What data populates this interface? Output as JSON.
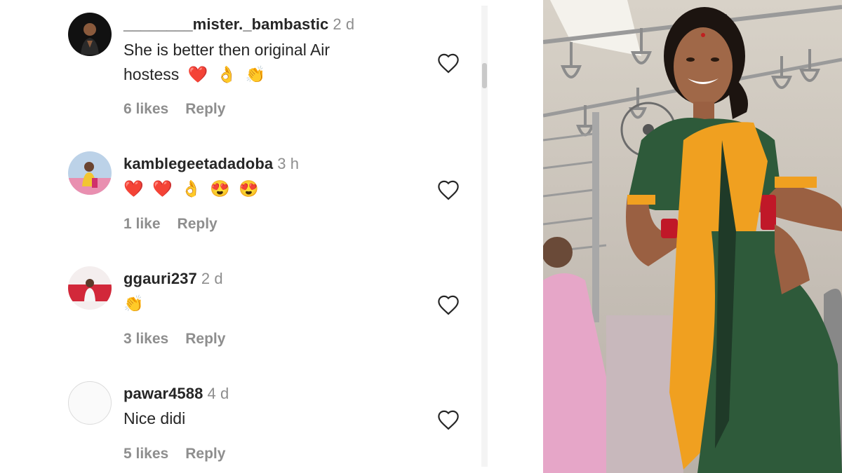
{
  "comments": [
    {
      "username": "________mister._bambastic",
      "time": "2 d",
      "text_line1": "She is better then original Air",
      "text_line2": "hostess",
      "emojis": [
        "❤️",
        "👌",
        "👏"
      ],
      "likes": "6 likes",
      "reply": "Reply"
    },
    {
      "username": "kamblegeetadadoba",
      "time": "3 h",
      "emojis": [
        "❤️",
        "❤️",
        "👌",
        "😍",
        "😍"
      ],
      "likes": "1 like",
      "reply": "Reply"
    },
    {
      "username": "ggauri237",
      "time": "2 d",
      "emojis": [
        "👏"
      ],
      "likes": "3 likes",
      "reply": "Reply"
    },
    {
      "username": "pawar4588",
      "time": "4 d",
      "text_line1": "Nice didi",
      "likes": "5 likes",
      "reply": "Reply"
    }
  ],
  "icons": {
    "like": "heart-outline-icon",
    "avatar_default": "default-avatar-icon"
  },
  "colors": {
    "username": "#262626",
    "secondary": "#8e8e8e",
    "heart": "#262626",
    "saree_orange": "#f0a020",
    "saree_green": "#2e5a3a"
  }
}
